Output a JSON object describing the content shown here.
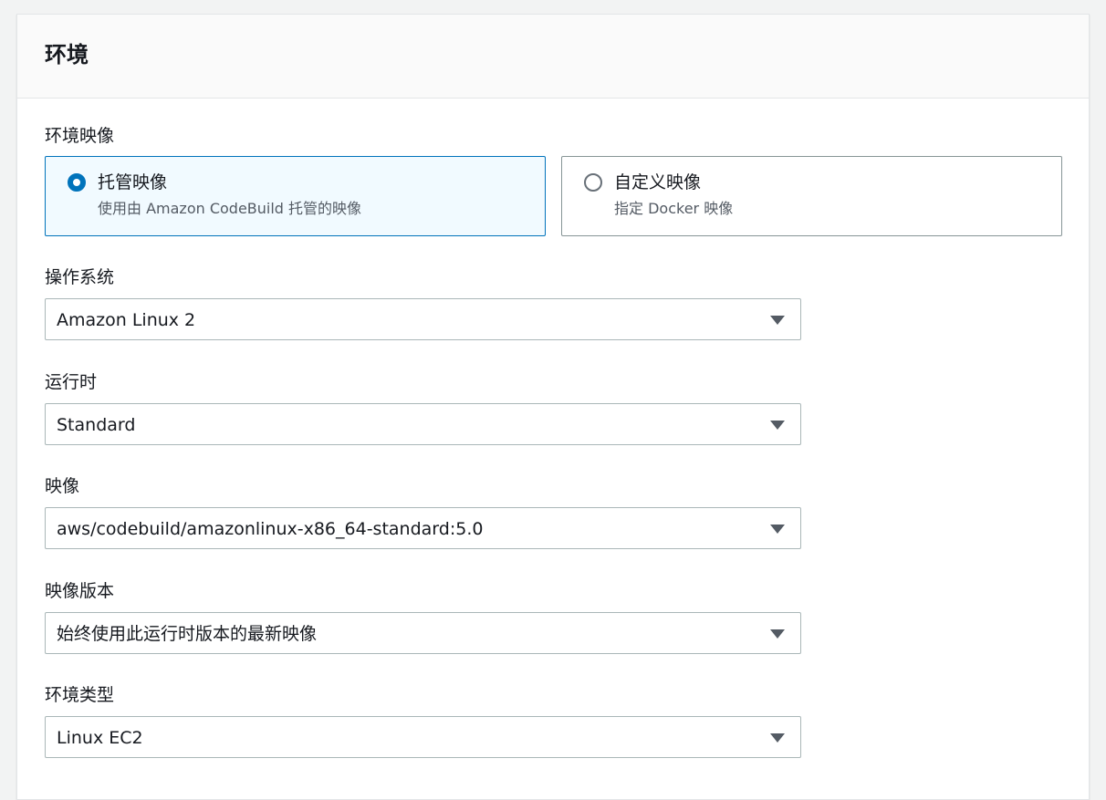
{
  "panel": {
    "title": "环境"
  },
  "image_source": {
    "label": "环境映像",
    "options": [
      {
        "title": "托管映像",
        "description": "使用由 Amazon CodeBuild 托管的映像",
        "selected": true
      },
      {
        "title": "自定义映像",
        "description": "指定 Docker 映像",
        "selected": false
      }
    ]
  },
  "fields": {
    "os": {
      "label": "操作系统",
      "value": "Amazon Linux 2"
    },
    "runtime": {
      "label": "运行时",
      "value": "Standard"
    },
    "image": {
      "label": "映像",
      "value": "aws/codebuild/amazonlinux-x86_64-standard:5.0"
    },
    "image_version": {
      "label": "映像版本",
      "value": "始终使用此运行时版本的最新映像"
    },
    "env_type": {
      "label": "环境类型",
      "value": "Linux EC2"
    }
  },
  "icons": {
    "select_caret": "caret-down-icon",
    "radio": "radio-icon"
  },
  "colors": {
    "accent": "#0073bb",
    "selected_tile_bg": "#f1faff",
    "border": "#879596",
    "text": "#16191f",
    "secondary_text": "#545b64"
  }
}
